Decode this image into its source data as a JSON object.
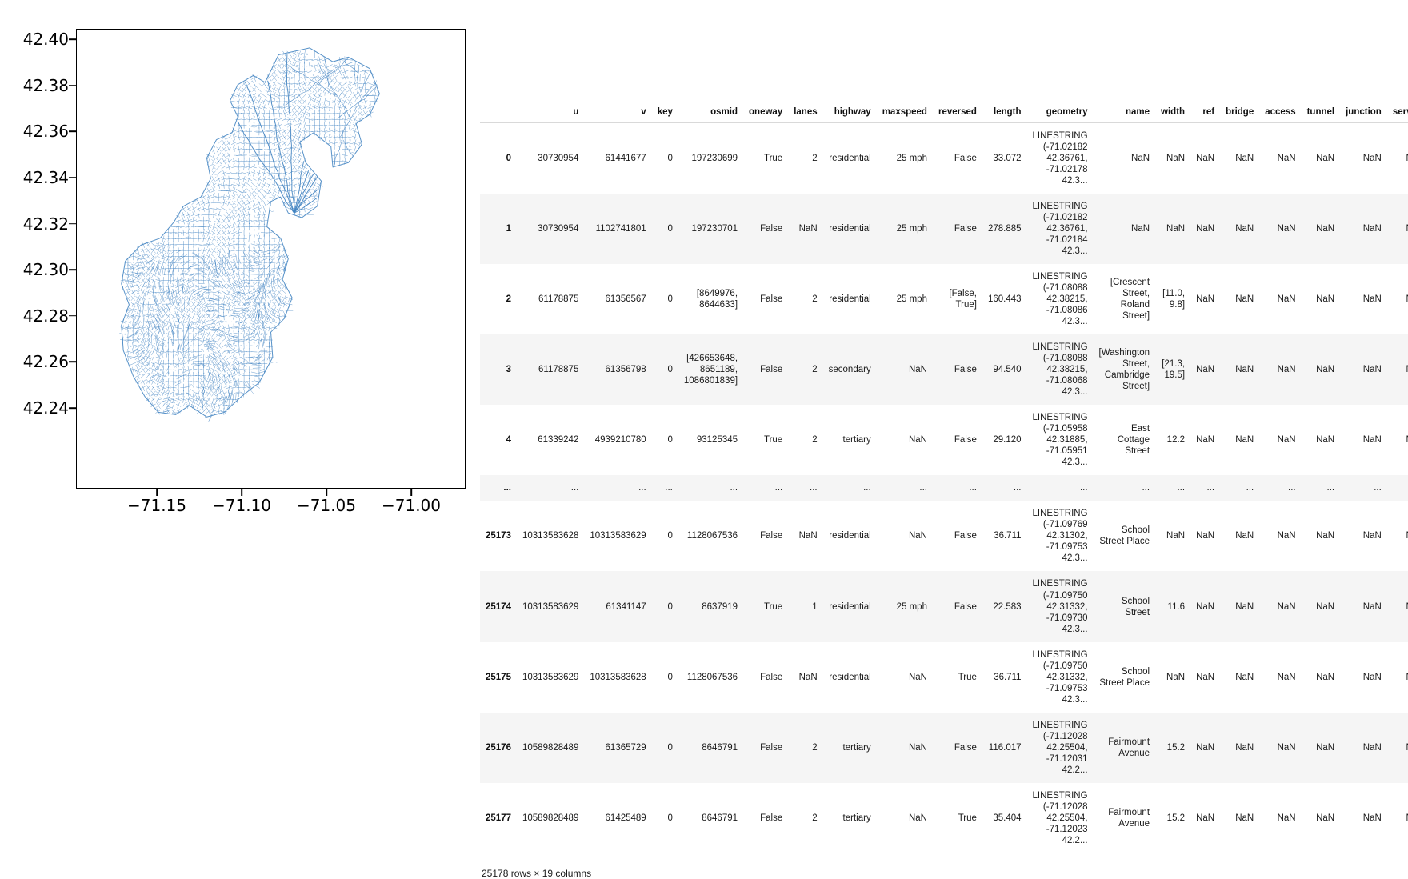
{
  "figure": {
    "name": "street-network-plot",
    "line_color": "#3a7ebf",
    "ytick_labels": [
      "42.40",
      "42.38",
      "42.36",
      "42.34",
      "42.32",
      "42.30",
      "42.28",
      "42.26",
      "42.24"
    ],
    "xtick_labels": [
      "−71.15",
      "−71.10",
      "−71.05",
      "−71.00"
    ]
  },
  "chart_data": {
    "type": "line",
    "title": "",
    "xlabel": "",
    "ylabel": "",
    "xlim": [
      -71.1915,
      -70.9855
    ],
    "ylim": [
      42.2265,
      42.4135
    ],
    "xticks": [
      -71.15,
      -71.1,
      -71.05,
      -71.0
    ],
    "yticks": [
      42.4,
      42.38,
      42.36,
      42.34,
      42.32,
      42.3,
      42.28,
      42.26,
      42.24
    ],
    "xtick_labels": [
      "−71.15",
      "−71.10",
      "−71.05",
      "−71.00"
    ],
    "ytick_labels": [
      "42.40",
      "42.38",
      "42.36",
      "42.34",
      "42.32",
      "42.30",
      "42.28",
      "42.26",
      "42.24"
    ],
    "grid": false,
    "legend": null,
    "series": [
      {
        "name": "street network edges (LINESTRING geometries)",
        "color": "#3a7ebf",
        "feature_count": 25178,
        "description": "Boston street network drawn as map-projected LINESTRING edges"
      }
    ]
  },
  "dataframe": {
    "shape_note": "25178 rows × 19 columns",
    "columns": [
      "u",
      "v",
      "key",
      "osmid",
      "oneway",
      "lanes",
      "highway",
      "maxspeed",
      "reversed",
      "length",
      "geometry",
      "name",
      "width",
      "ref",
      "bridge",
      "access",
      "tunnel",
      "junction",
      "service"
    ],
    "rows": [
      {
        "index": "0",
        "u": "30730954",
        "v": "61441677",
        "key": "0",
        "osmid": "197230699",
        "oneway": "True",
        "lanes": "2",
        "highway": "residential",
        "maxspeed": "25 mph",
        "reversed": "False",
        "length": "33.072",
        "geometry": "LINESTRING (-71.02182 42.36761, -71.02178 42.3...",
        "name": "NaN",
        "width": "NaN",
        "ref": "NaN",
        "bridge": "NaN",
        "access": "NaN",
        "tunnel": "NaN",
        "junction": "NaN",
        "service": "NaN"
      },
      {
        "index": "1",
        "u": "30730954",
        "v": "1102741801",
        "key": "0",
        "osmid": "197230701",
        "oneway": "False",
        "lanes": "NaN",
        "highway": "residential",
        "maxspeed": "25 mph",
        "reversed": "False",
        "length": "278.885",
        "geometry": "LINESTRING (-71.02182 42.36761, -71.02184 42.3...",
        "name": "NaN",
        "width": "NaN",
        "ref": "NaN",
        "bridge": "NaN",
        "access": "NaN",
        "tunnel": "NaN",
        "junction": "NaN",
        "service": "NaN"
      },
      {
        "index": "2",
        "u": "61178875",
        "v": "61356567",
        "key": "0",
        "osmid": "[8649976, 8644633]",
        "oneway": "False",
        "lanes": "2",
        "highway": "residential",
        "maxspeed": "25 mph",
        "reversed": "[False, True]",
        "length": "160.443",
        "geometry": "LINESTRING (-71.08088 42.38215, -71.08086 42.3...",
        "name": "[Crescent Street, Roland Street]",
        "width": "[11.0, 9.8]",
        "ref": "NaN",
        "bridge": "NaN",
        "access": "NaN",
        "tunnel": "NaN",
        "junction": "NaN",
        "service": "NaN"
      },
      {
        "index": "3",
        "u": "61178875",
        "v": "61356798",
        "key": "0",
        "osmid": "[426653648, 8651189, 1086801839]",
        "oneway": "False",
        "lanes": "2",
        "highway": "secondary",
        "maxspeed": "NaN",
        "reversed": "False",
        "length": "94.540",
        "geometry": "LINESTRING (-71.08088 42.38215, -71.08068 42.3...",
        "name": "[Washington Street, Cambridge Street]",
        "width": "[21.3, 19.5]",
        "ref": "NaN",
        "bridge": "NaN",
        "access": "NaN",
        "tunnel": "NaN",
        "junction": "NaN",
        "service": "NaN"
      },
      {
        "index": "4",
        "u": "61339242",
        "v": "4939210780",
        "key": "0",
        "osmid": "93125345",
        "oneway": "True",
        "lanes": "2",
        "highway": "tertiary",
        "maxspeed": "NaN",
        "reversed": "False",
        "length": "29.120",
        "geometry": "LINESTRING (-71.05958 42.31885, -71.05951 42.3...",
        "name": "East Cottage Street",
        "width": "12.2",
        "ref": "NaN",
        "bridge": "NaN",
        "access": "NaN",
        "tunnel": "NaN",
        "junction": "NaN",
        "service": "NaN"
      },
      {
        "index": "...",
        "u": "...",
        "v": "...",
        "key": "...",
        "osmid": "...",
        "oneway": "...",
        "lanes": "...",
        "highway": "...",
        "maxspeed": "...",
        "reversed": "...",
        "length": "...",
        "geometry": "...",
        "name": "...",
        "width": "...",
        "ref": "...",
        "bridge": "...",
        "access": "...",
        "tunnel": "...",
        "junction": "...",
        "service": "..."
      },
      {
        "index": "25173",
        "u": "10313583628",
        "v": "10313583629",
        "key": "0",
        "osmid": "1128067536",
        "oneway": "False",
        "lanes": "NaN",
        "highway": "residential",
        "maxspeed": "NaN",
        "reversed": "False",
        "length": "36.711",
        "geometry": "LINESTRING (-71.09769 42.31302, -71.09753 42.3...",
        "name": "School Street Place",
        "width": "NaN",
        "ref": "NaN",
        "bridge": "NaN",
        "access": "NaN",
        "tunnel": "NaN",
        "junction": "NaN",
        "service": "NaN"
      },
      {
        "index": "25174",
        "u": "10313583629",
        "v": "61341147",
        "key": "0",
        "osmid": "8637919",
        "oneway": "True",
        "lanes": "1",
        "highway": "residential",
        "maxspeed": "25 mph",
        "reversed": "False",
        "length": "22.583",
        "geometry": "LINESTRING (-71.09750 42.31332, -71.09730 42.3...",
        "name": "School Street",
        "width": "11.6",
        "ref": "NaN",
        "bridge": "NaN",
        "access": "NaN",
        "tunnel": "NaN",
        "junction": "NaN",
        "service": "NaN"
      },
      {
        "index": "25175",
        "u": "10313583629",
        "v": "10313583628",
        "key": "0",
        "osmid": "1128067536",
        "oneway": "False",
        "lanes": "NaN",
        "highway": "residential",
        "maxspeed": "NaN",
        "reversed": "True",
        "length": "36.711",
        "geometry": "LINESTRING (-71.09750 42.31332, -71.09753 42.3...",
        "name": "School Street Place",
        "width": "NaN",
        "ref": "NaN",
        "bridge": "NaN",
        "access": "NaN",
        "tunnel": "NaN",
        "junction": "NaN",
        "service": "NaN"
      },
      {
        "index": "25176",
        "u": "10589828489",
        "v": "61365729",
        "key": "0",
        "osmid": "8646791",
        "oneway": "False",
        "lanes": "2",
        "highway": "tertiary",
        "maxspeed": "NaN",
        "reversed": "False",
        "length": "116.017",
        "geometry": "LINESTRING (-71.12028 42.25504, -71.12031 42.2...",
        "name": "Fairmount Avenue",
        "width": "15.2",
        "ref": "NaN",
        "bridge": "NaN",
        "access": "NaN",
        "tunnel": "NaN",
        "junction": "NaN",
        "service": "NaN"
      },
      {
        "index": "25177",
        "u": "10589828489",
        "v": "61425489",
        "key": "0",
        "osmid": "8646791",
        "oneway": "False",
        "lanes": "2",
        "highway": "tertiary",
        "maxspeed": "NaN",
        "reversed": "True",
        "length": "35.404",
        "geometry": "LINESTRING (-71.12028 42.25504, -71.12023 42.2...",
        "name": "Fairmount Avenue",
        "width": "15.2",
        "ref": "NaN",
        "bridge": "NaN",
        "access": "NaN",
        "tunnel": "NaN",
        "junction": "NaN",
        "service": "NaN"
      }
    ]
  }
}
